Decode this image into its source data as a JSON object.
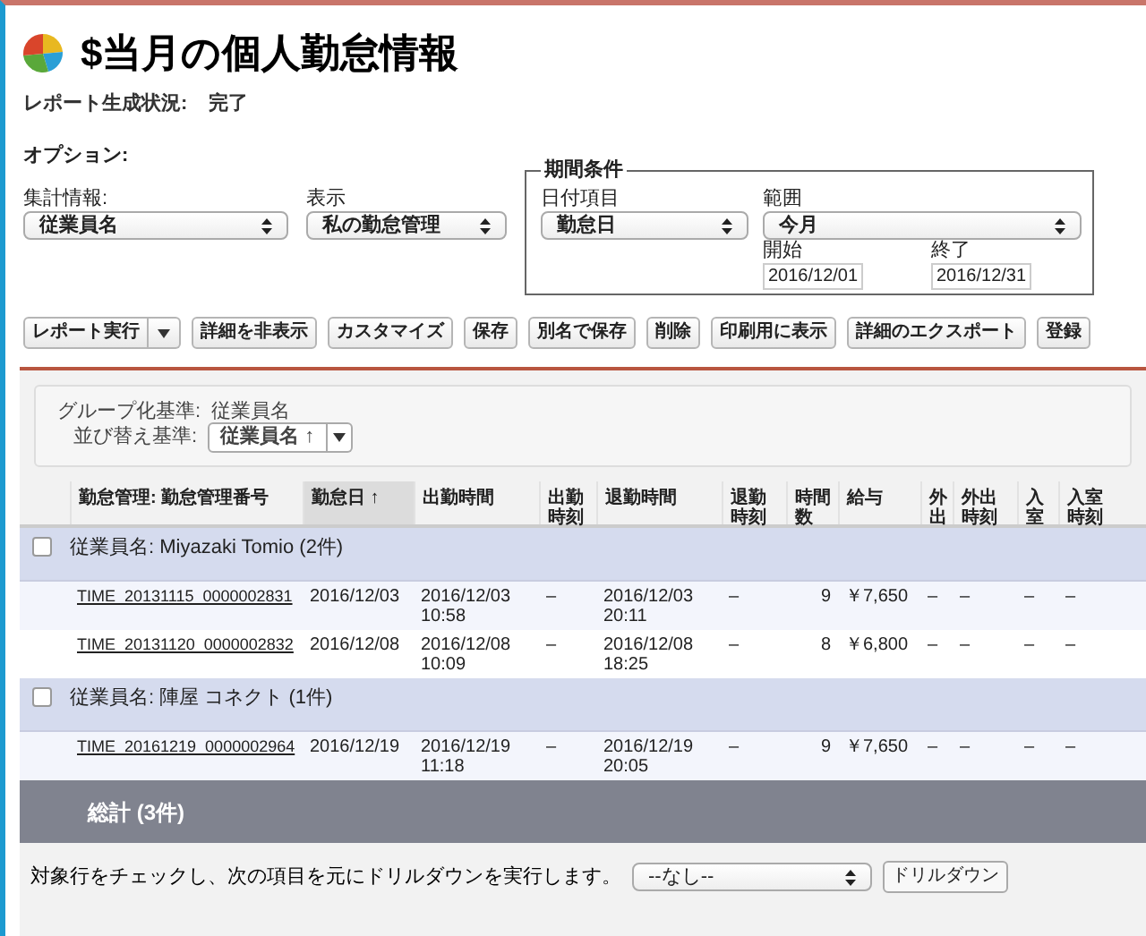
{
  "title": "$当月の個人勤怠情報",
  "status": {
    "label": "レポート生成状況:",
    "value": "完了"
  },
  "options": {
    "label": "オプション:",
    "fields": [
      {
        "label": "集計情報:",
        "value": "従業員名"
      },
      {
        "label": "表示",
        "value": "私の勤怠管理"
      }
    ]
  },
  "period": {
    "legend": "期間条件",
    "date_field": {
      "label": "日付項目",
      "value": "勤怠日"
    },
    "range": {
      "label": "範囲",
      "value": "今月"
    },
    "start": {
      "label": "開始",
      "value": "2016/12/01"
    },
    "end": {
      "label": "終了",
      "value": "2016/12/31"
    }
  },
  "buttons": [
    "レポート実行",
    "詳細を非表示",
    "カスタマイズ",
    "保存",
    "別名で保存",
    "削除",
    "印刷用に表示",
    "詳細のエクスポート",
    "登録"
  ],
  "grouping": {
    "group_label": "グループ化基準:",
    "group_value": "従業員名",
    "sort_label": "並び替え基準:",
    "sort_value": "従業員名 ↑"
  },
  "table": {
    "columns": [
      {
        "label": "勤怠管理: 勤怠管理番号",
        "sorted": false
      },
      {
        "label": "勤怠日",
        "sorted": true,
        "sort_indicator": "↑"
      },
      {
        "label": "出勤時間",
        "sorted": false
      },
      {
        "label": "出勤時刻",
        "sorted": false
      },
      {
        "label": "退勤時間",
        "sorted": false
      },
      {
        "label": "退勤時刻",
        "sorted": false
      },
      {
        "label": "時間数",
        "sorted": false
      },
      {
        "label": "給与",
        "sorted": false
      },
      {
        "label": "外出",
        "sorted": false
      },
      {
        "label": "外出時刻",
        "sorted": false
      },
      {
        "label": "入室",
        "sorted": false
      },
      {
        "label": "入室時刻",
        "sorted": false
      }
    ],
    "rows": [
      {
        "kind": "group",
        "label": "従業員名: Miyazaki Tomio (2件)",
        "checked": false
      },
      {
        "kind": "detail",
        "cells": [
          "TIME_20131115_0000002831",
          "2016/12/03",
          "2016/12/03 10:58",
          "–",
          "2016/12/03 20:11",
          "–",
          "9",
          "￥7,650",
          "–",
          "–",
          "–",
          "–"
        ]
      },
      {
        "kind": "detail",
        "cells": [
          "TIME_20131120_0000002832",
          "2016/12/08",
          "2016/12/08 10:09",
          "–",
          "2016/12/08 18:25",
          "–",
          "8",
          "￥6,800",
          "–",
          "–",
          "–",
          "–"
        ]
      },
      {
        "kind": "group",
        "label": "従業員名: 陣屋 コネクト (1件)",
        "checked": false
      },
      {
        "kind": "detail",
        "cells": [
          "TIME_20161219_0000002964",
          "2016/12/19",
          "2016/12/19 11:18",
          "–",
          "2016/12/19 20:05",
          "–",
          "9",
          "￥7,650",
          "–",
          "–",
          "–",
          "–"
        ]
      },
      {
        "kind": "total",
        "label": "総計 (3件)"
      }
    ]
  },
  "drilldown": {
    "instruction": "対象行をチェックし、次の項目を元にドリルダウンを実行します。",
    "select_value": "--なし--",
    "button": "ドリルダウン"
  }
}
